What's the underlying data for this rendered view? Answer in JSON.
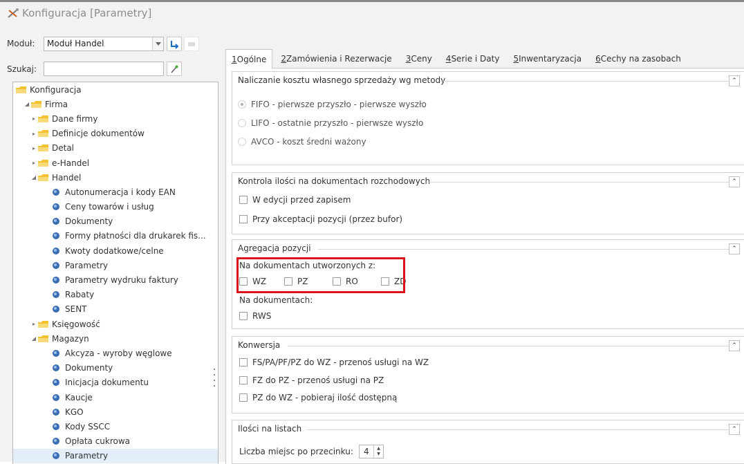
{
  "window": {
    "title": "Konfiguracja [Parametry]"
  },
  "toolbar": {
    "module_label": "Moduł:",
    "module_value": "Moduł Handel",
    "search_label": "Szukaj:",
    "search_value": ""
  },
  "tree": [
    {
      "label": "Konfiguracja",
      "level": 0,
      "type": "folder",
      "exp": ""
    },
    {
      "label": "Firma",
      "level": 1,
      "type": "folder",
      "exp": "◢"
    },
    {
      "label": "Dane firmy",
      "level": 2,
      "type": "folder",
      "exp": "▸"
    },
    {
      "label": "Definicje dokumentów",
      "level": 2,
      "type": "folder",
      "exp": "▸"
    },
    {
      "label": "Detal",
      "level": 2,
      "type": "folder",
      "exp": "▸"
    },
    {
      "label": "e-Handel",
      "level": 2,
      "type": "folder",
      "exp": "▸"
    },
    {
      "label": "Handel",
      "level": 2,
      "type": "folder",
      "exp": "◢"
    },
    {
      "label": "Autonumeracja i kody EAN",
      "level": 3,
      "type": "leaf",
      "exp": ""
    },
    {
      "label": "Ceny towarów i usług",
      "level": 3,
      "type": "leaf",
      "exp": ""
    },
    {
      "label": "Dokumenty",
      "level": 3,
      "type": "leaf",
      "exp": ""
    },
    {
      "label": "Formy płatności dla drukarek fis...",
      "level": 3,
      "type": "leaf",
      "exp": ""
    },
    {
      "label": "Kwoty dodatkowe/celne",
      "level": 3,
      "type": "leaf",
      "exp": ""
    },
    {
      "label": "Parametry",
      "level": 3,
      "type": "leaf",
      "exp": ""
    },
    {
      "label": "Parametry wydruku faktury",
      "level": 3,
      "type": "leaf",
      "exp": ""
    },
    {
      "label": "Rabaty",
      "level": 3,
      "type": "leaf",
      "exp": ""
    },
    {
      "label": "SENT",
      "level": 3,
      "type": "leaf",
      "exp": ""
    },
    {
      "label": "Księgowość",
      "level": 2,
      "type": "folder",
      "exp": "▸"
    },
    {
      "label": "Magazyn",
      "level": 2,
      "type": "folder",
      "exp": "◢"
    },
    {
      "label": "Akcyza - wyroby węglowe",
      "level": 3,
      "type": "leaf",
      "exp": ""
    },
    {
      "label": "Dokumenty",
      "level": 3,
      "type": "leaf",
      "exp": ""
    },
    {
      "label": "Inicjacja dokumentu",
      "level": 3,
      "type": "leaf",
      "exp": ""
    },
    {
      "label": "Kaucje",
      "level": 3,
      "type": "leaf",
      "exp": ""
    },
    {
      "label": "KGO",
      "level": 3,
      "type": "leaf",
      "exp": ""
    },
    {
      "label": "Kody SSCC",
      "level": 3,
      "type": "leaf",
      "exp": ""
    },
    {
      "label": "Opłata cukrowa",
      "level": 3,
      "type": "leaf",
      "exp": ""
    },
    {
      "label": "Parametry",
      "level": 3,
      "type": "leaf",
      "exp": "",
      "selected": true
    }
  ],
  "tabs": [
    {
      "key": "1",
      "label": " Ogólne"
    },
    {
      "key": "2",
      "label": " Zamówienia i Rezerwacje"
    },
    {
      "key": "3",
      "label": " Ceny"
    },
    {
      "key": "4",
      "label": " Serie i Daty"
    },
    {
      "key": "5",
      "label": " Inwentaryzacja"
    },
    {
      "key": "6",
      "label": " Cechy na zasobach"
    }
  ],
  "groups": {
    "cost": {
      "title": "Naliczanie kosztu własnego sprzedaży wg metody",
      "options": [
        "FIFO - pierwsze przyszło - pierwsze wyszło",
        "LIFO - ostatnie przyszło - pierwsze wyszło",
        "AVCO - koszt średni ważony"
      ],
      "selected": 0
    },
    "quantity": {
      "title": "Kontrola ilości na dokumentach rozchodowych",
      "options": [
        "W edycji przed zapisem",
        "Przy akceptacji pozycji (przez bufor)"
      ]
    },
    "aggregation": {
      "title": "Agregacja pozycji",
      "created_from_label": "Na dokumentach utworzonych z:",
      "created_from_options": [
        "WZ",
        "PZ",
        "RO",
        "ZD"
      ],
      "on_documents_label": "Na dokumentach:",
      "on_documents_options": [
        "RWS"
      ]
    },
    "conversion": {
      "title": "Konwersja",
      "options": [
        "FS/PA/PF/PZ do WZ - przenoś usługi na WZ",
        "FZ do PZ - przenoś usługi na PZ",
        "PZ do WZ - pobieraj ilość dostępną"
      ]
    },
    "lists": {
      "title": "Ilości na listach",
      "decimal_label": "Liczba miejsc po przecinku:",
      "decimal_value": "4"
    }
  },
  "colors": {
    "folder": "#f2c230",
    "gear": "#3b6db3",
    "highlight": "#d8131b",
    "refresh": "#1d6fc4"
  }
}
